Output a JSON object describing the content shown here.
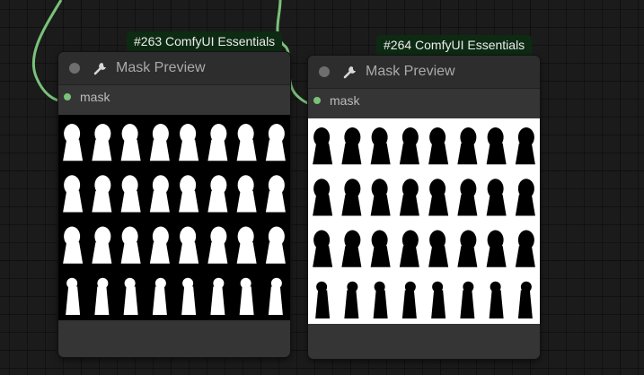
{
  "node_a": {
    "badge": "#263 ComfyUI Essentials",
    "title": "Mask Preview",
    "input_label": "mask",
    "preview": {
      "background": "#000000",
      "foreground": "#ffffff",
      "columns": 8,
      "rows": 4
    }
  },
  "node_b": {
    "badge": "#264 ComfyUI Essentials",
    "title": "Mask Preview",
    "input_label": "mask",
    "preview": {
      "background": "#ffffff",
      "foreground": "#000000",
      "columns": 8,
      "rows": 4
    }
  },
  "colors": {
    "wire": "#7ac27a",
    "slot": "#7ac27a",
    "badge_bg": "#0d2a12",
    "node_bg": "#353535",
    "canvas_bg": "#1b1b1b"
  },
  "icons": {
    "title_icon": "wrench-icon",
    "status_icon": "node-status-dot-icon"
  }
}
